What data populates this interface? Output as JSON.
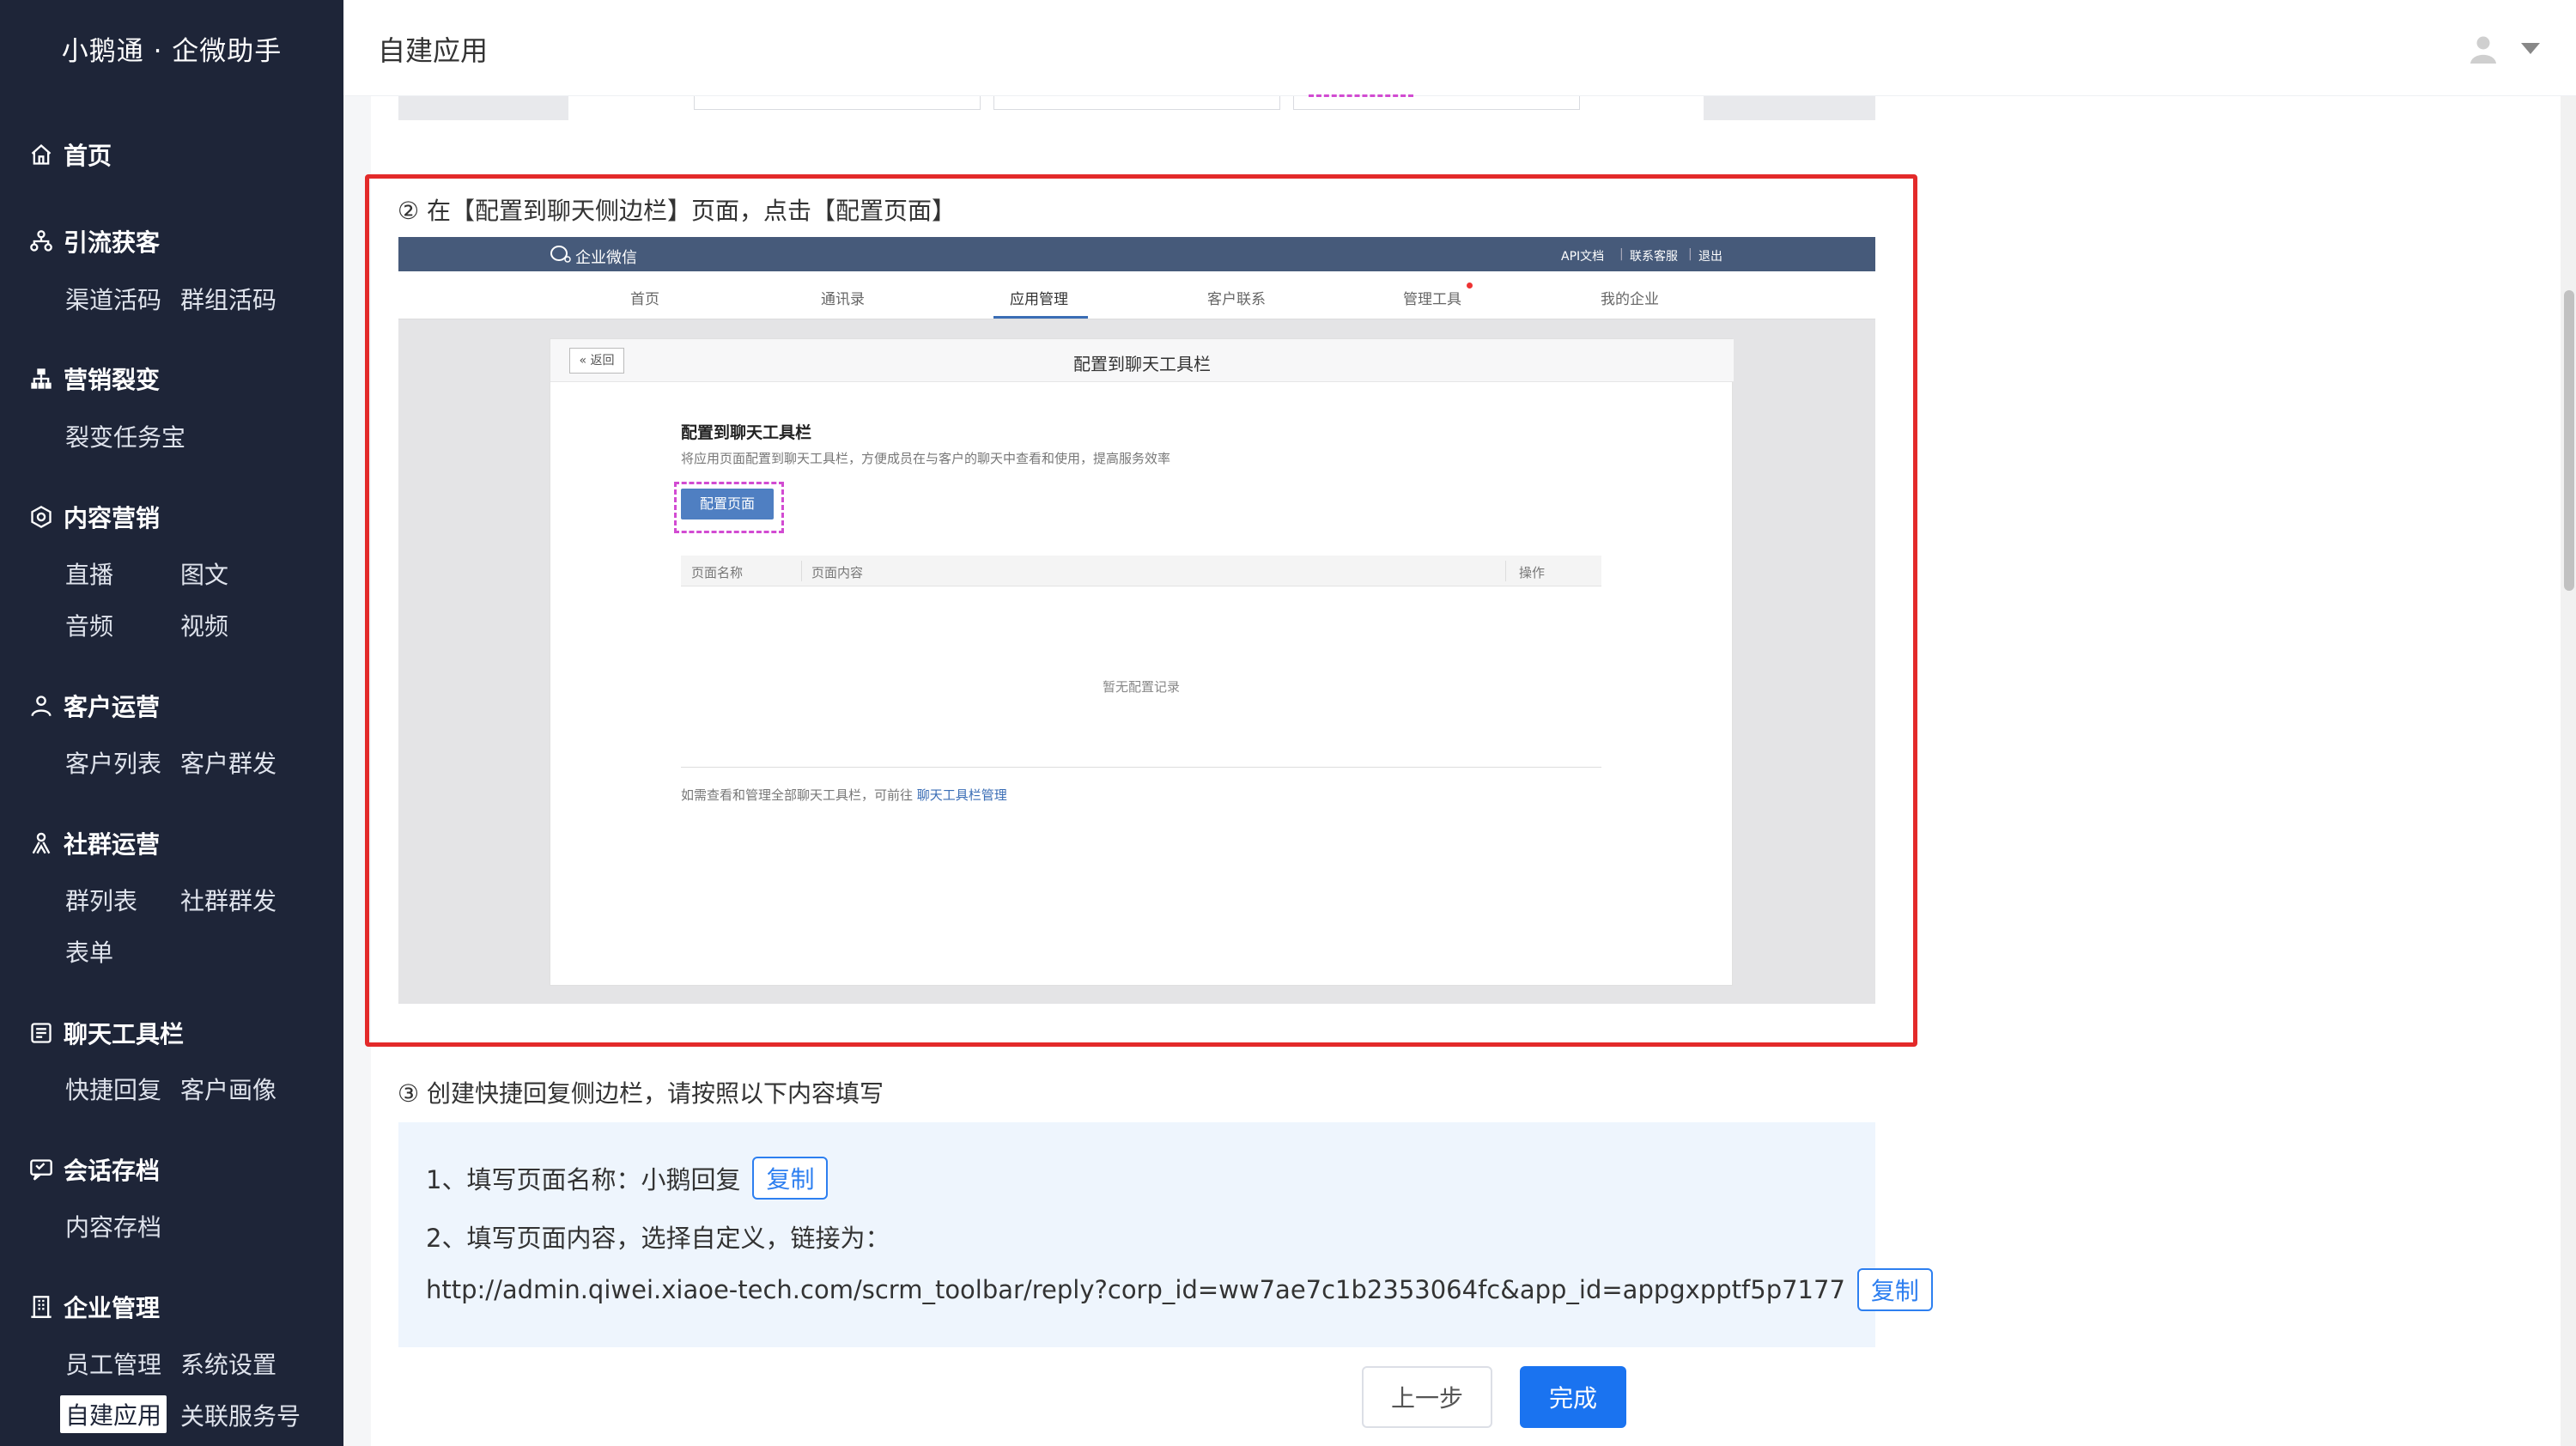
{
  "brand": "小鹅通 · 企微助手",
  "header": {
    "title": "自建应用"
  },
  "sidebar": {
    "groups": [
      {
        "title": "首页",
        "icon": "home-icon",
        "items": []
      },
      {
        "title": "引流获客",
        "icon": "network-icon",
        "items": [
          "渠道活码",
          "群组活码"
        ]
      },
      {
        "title": "营销裂变",
        "icon": "hierarchy-icon",
        "items": [
          "裂变任务宝"
        ]
      },
      {
        "title": "内容营销",
        "icon": "badge-icon",
        "items": [
          "直播",
          "图文",
          "音频",
          "视频"
        ]
      },
      {
        "title": "客户运营",
        "icon": "user-icon",
        "items": [
          "客户列表",
          "客户群发"
        ]
      },
      {
        "title": "社群运营",
        "icon": "group-icon",
        "items": [
          "群列表",
          "社群群发",
          "表单"
        ]
      },
      {
        "title": "聊天工具栏",
        "icon": "toolbar-icon",
        "items": [
          "快捷回复",
          "客户画像"
        ]
      },
      {
        "title": "会话存档",
        "icon": "chat-archive-icon",
        "items": [
          "内容存档"
        ]
      },
      {
        "title": "企业管理",
        "icon": "building-icon",
        "items": [
          "员工管理",
          "系统设置",
          "自建应用",
          "关联服务号"
        ]
      }
    ],
    "active_item": "自建应用"
  },
  "step2": {
    "label": "② 在【配置到聊天侧边栏】页面，点击【配置页面】",
    "screenshot": {
      "logo": "企业微信",
      "top_links": [
        "API文档",
        "联系客服",
        "退出"
      ],
      "tabs": [
        "首页",
        "通讯录",
        "应用管理",
        "客户联系",
        "管理工具",
        "我的企业"
      ],
      "active_tab": "应用管理",
      "back_label": "« 返回",
      "card_title": "配置到聊天工具栏",
      "section_title": "配置到聊天工具栏",
      "section_desc": "将应用页面配置到聊天工具栏，方便成员在与客户的聊天中查看和使用，提高服务效率",
      "config_button": "配置页面",
      "table_headers": [
        "页面名称",
        "页面内容",
        "操作"
      ],
      "empty_text": "暂无配置记录",
      "footer_text": "如需查看和管理全部聊天工具栏，可前往 ",
      "footer_link": "聊天工具栏管理"
    }
  },
  "step3": {
    "label": "③ 创建快捷回复侧边栏，请按照以下内容填写",
    "line1": "1、填写页面名称：小鹅回复",
    "line2": "2、填写页面内容，选择自定义，链接为：",
    "url": "http://admin.qiwei.xiaoe-tech.com/scrm_toolbar/reply?corp_id=ww7ae7c1b2353064fc&app_id=appgxpptf5p7177",
    "copy_label": "复制"
  },
  "footer": {
    "prev_label": "上一步",
    "done_label": "完成"
  },
  "colors": {
    "sidebar_bg": "#1e2538",
    "highlight_red": "#e32a2a",
    "primary_blue": "#1a73f0"
  }
}
